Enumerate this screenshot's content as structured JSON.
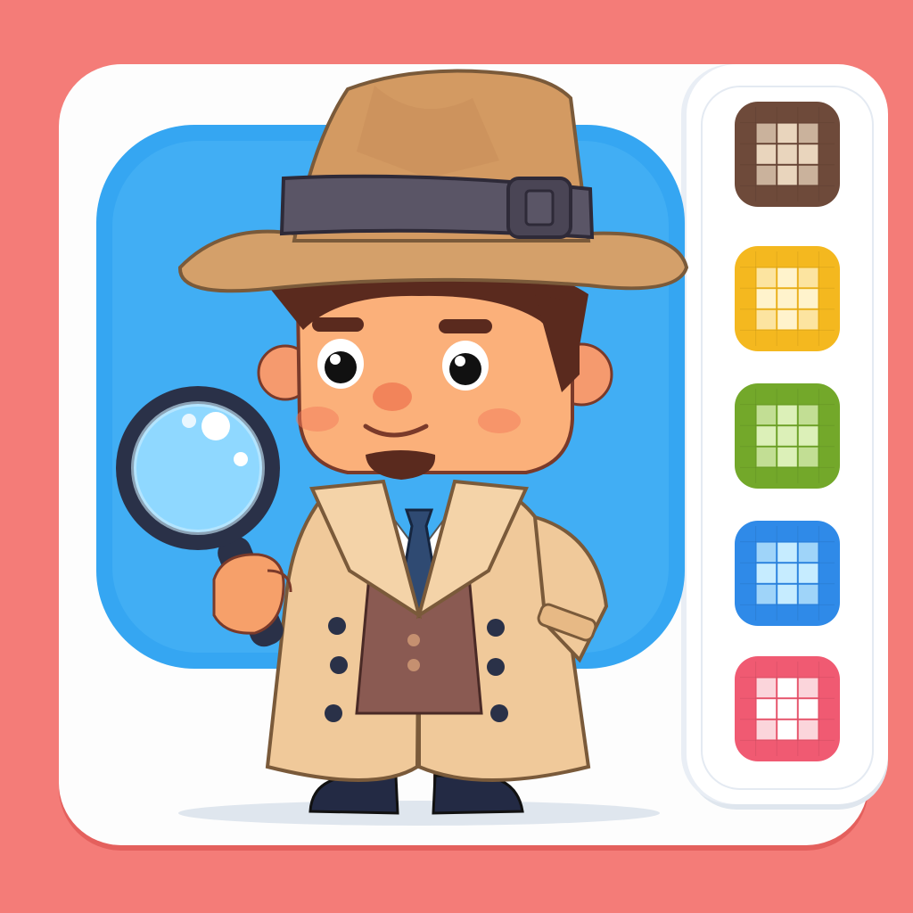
{
  "scene": {
    "accent_background": "#f47c78",
    "portrait_background": "#35a6f2",
    "character": "detective",
    "character_colors": {
      "hat": "#d4a06a",
      "hat_band": "#5a5566",
      "coat": "#f0c99a",
      "vest": "#8a5a52",
      "tie": "#2f4a72",
      "skin": "#fbb07a",
      "hair": "#5a2a1e"
    },
    "held_item": "magnifying-glass-icon"
  },
  "color_options": [
    {
      "id": "brown",
      "color": "#6e4a3a",
      "light": "#e9d5bd",
      "selected": false
    },
    {
      "id": "yellow",
      "color": "#f4b81f",
      "light": "#fff3cc",
      "selected": false
    },
    {
      "id": "green",
      "color": "#73a82a",
      "light": "#dcf0b8",
      "selected": false
    },
    {
      "id": "blue",
      "color": "#2f8ae8",
      "light": "#c6ecff",
      "selected": false
    },
    {
      "id": "pink",
      "color": "#f05a72",
      "light": "#ffffff",
      "selected": false
    }
  ]
}
